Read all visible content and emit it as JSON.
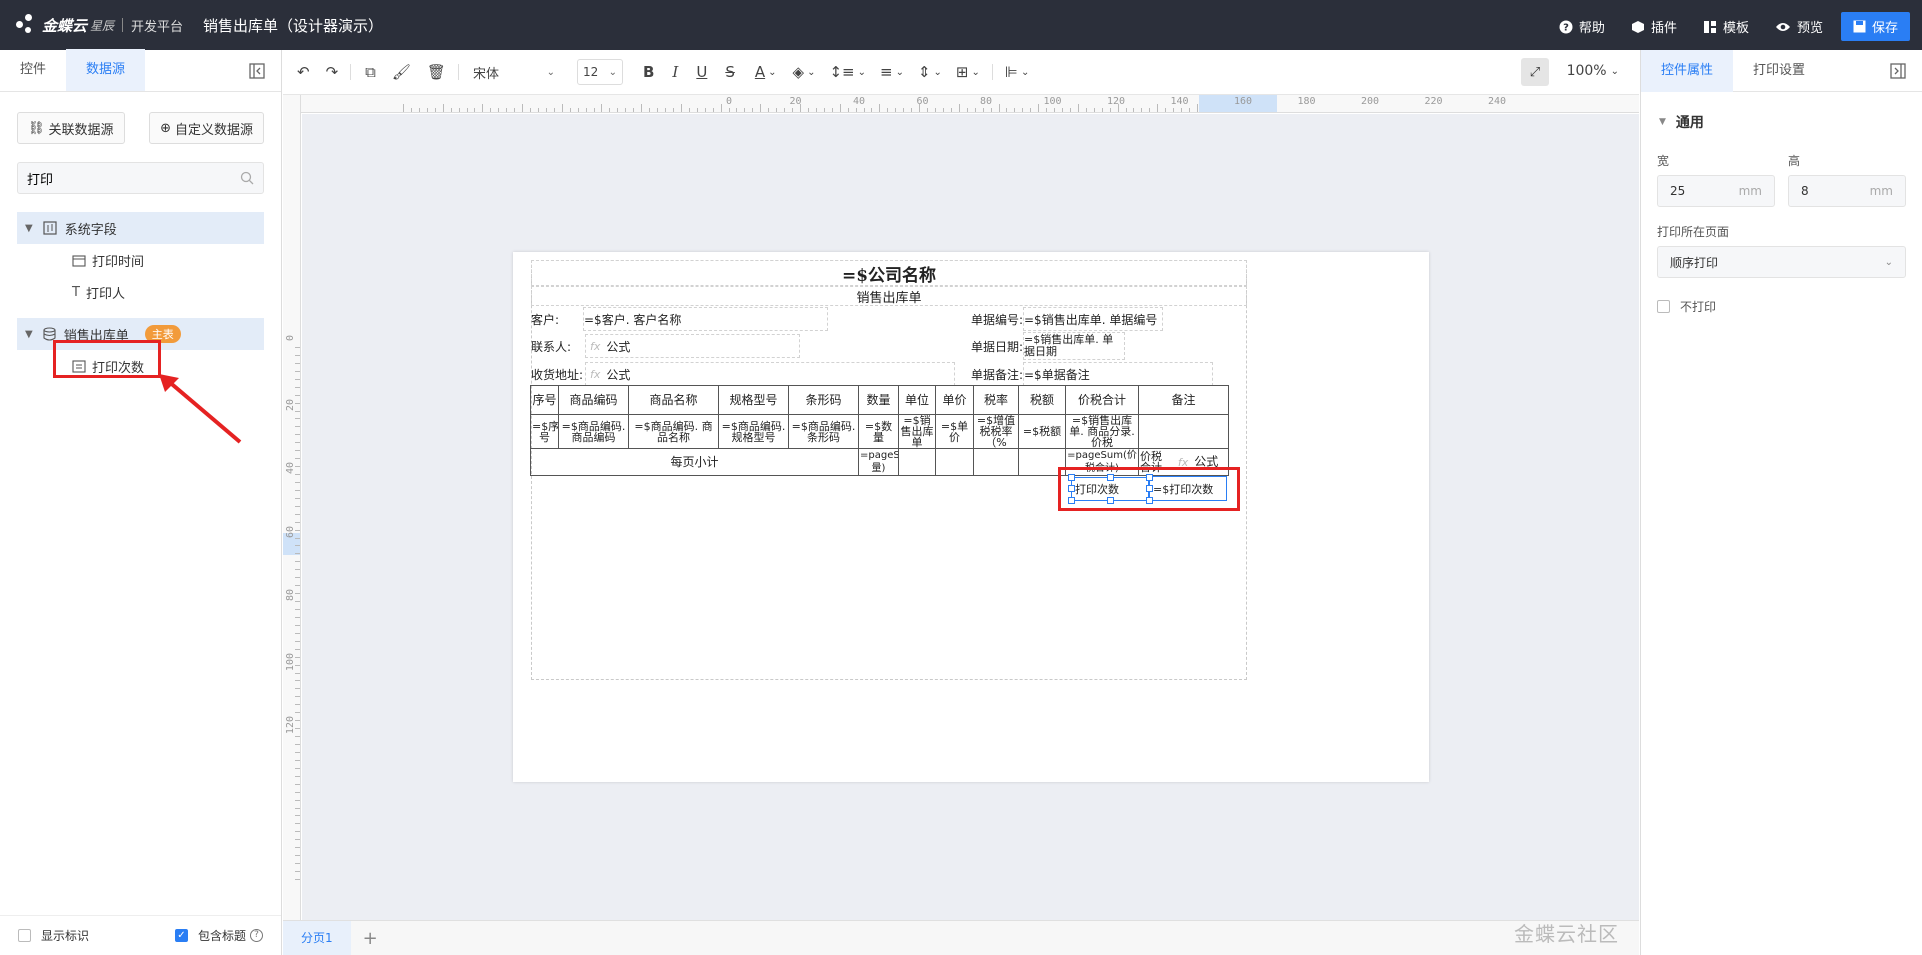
{
  "app": {
    "logo_text": "金蝶云",
    "logo_sub": "星辰",
    "platform": "开发平台",
    "doc_title": "销售出库单（设计器演示）"
  },
  "top_actions": {
    "help": "帮助",
    "plugin": "插件",
    "template": "模板",
    "preview": "预览",
    "save": "保存"
  },
  "left_panel": {
    "tabs": [
      "控件",
      "数据源"
    ],
    "active_tab": "数据源",
    "btn_link_ds": "关联数据源",
    "btn_custom_ds": "自定义数据源",
    "search_value": "打印",
    "groups": [
      {
        "label": "系统字段",
        "items": [
          "打印时间",
          "打印人"
        ]
      },
      {
        "label": "销售出库单",
        "badge": "主表",
        "items": [
          "打印次数"
        ]
      }
    ],
    "show_marks": "显示标识",
    "include_title": "包含标题"
  },
  "toolbar": {
    "font": "宋体",
    "size": "12",
    "zoom": "100%"
  },
  "rulers": {
    "h": [
      "0",
      "20",
      "40",
      "60",
      "80",
      "100",
      "120",
      "140",
      "160",
      "180",
      "200",
      "220",
      "240"
    ],
    "v": [
      "0",
      "20",
      "40",
      "60",
      "80",
      "100",
      "120"
    ]
  },
  "report": {
    "company": "=$公司名称",
    "doc_name": "销售出库单",
    "customer_label": "客户:",
    "customer_value": "=$客户. 客户名称",
    "contact_label": "联系人:",
    "contact_value": "公式",
    "address_label": "收货地址:",
    "address_value": "公式",
    "billno_label": "单据编号:",
    "billno_value": "=$销售出库单. 单据编号",
    "billdate_label": "单据日期:",
    "billdate_value": "=$销售出库单. 单据日期",
    "remark_label": "单据备注:",
    "remark_value": "=$单据备注",
    "fx": "fx",
    "columns": [
      "序号",
      "商品编码",
      "商品名称",
      "规格型号",
      "条形码",
      "数量",
      "单位",
      "单价",
      "税率",
      "税额",
      "价税合计",
      "备注"
    ],
    "row": [
      "=$序号",
      "=$商品编码. 商品编码",
      "=$商品编码. 商品名称",
      "=$商品编码. 规格型号",
      "=$商品编码. 条形码",
      "=$数量",
      "=$销售出库单",
      "=$单价",
      "=$增值税税率（%",
      "=$税额",
      "=$销售出库单. 商品分录. 价税",
      ""
    ],
    "subtotal_label": "每页小计",
    "subtotal_qty": "=pageSum(数量)",
    "subtotal_amount": "=pageSum(价税合计)",
    "subtotal_amount_label": "价税合计",
    "subtotal_formula": "公式",
    "print_count_label": "打印次数",
    "print_count_value": "=$打印次数"
  },
  "bottom": {
    "page_tab": "分页1",
    "watermark": "金蝶云社区"
  },
  "right_panel": {
    "tabs": [
      "控件属性",
      "打印设置"
    ],
    "active_tab": "控件属性",
    "section": "通用",
    "width_label": "宽",
    "width_value": "25",
    "height_label": "高",
    "height_value": "8",
    "unit": "mm",
    "page_label": "打印所在页面",
    "page_value": "顺序打印",
    "no_print": "不打印"
  },
  "colors": {
    "topbar": "#2b2f3a",
    "accent": "#2a7ef4",
    "highlight": "#e52222",
    "badge": "#f29b3b"
  }
}
